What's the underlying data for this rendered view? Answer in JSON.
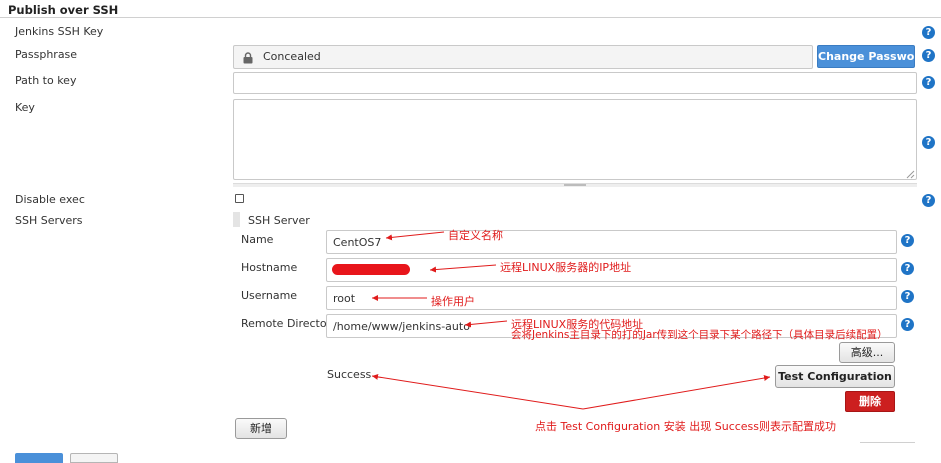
{
  "section": {
    "title": "Publish over SSH"
  },
  "form": {
    "jenkins_ssh_key_label": "Jenkins SSH Key",
    "passphrase_label": "Passphrase",
    "passphrase_value": "Concealed",
    "change_password_label": "Change Password",
    "path_to_key_label": "Path to key",
    "path_to_key_value": "",
    "key_label": "Key",
    "key_value": "",
    "disable_exec_label": "Disable exec",
    "disable_exec_checked": false,
    "ssh_servers_label": "SSH Servers"
  },
  "server": {
    "header": "SSH Server",
    "name_label": "Name",
    "name_value": "CentOS7",
    "hostname_label": "Hostname",
    "hostname_value": "",
    "username_label": "Username",
    "username_value": "root",
    "remote_directory_label": "Remote Directory",
    "remote_directory_value": "/home/www/jenkins-auto",
    "advanced_label": "高级...",
    "status_text": "Success",
    "test_configuration_label": "Test Configuration",
    "delete_label": "删除"
  },
  "add_label": "新增",
  "help_glyph": "?",
  "annotations": {
    "name": "自定义名称",
    "hostname": "远程LINUX服务器的IP地址",
    "username": "操作用户",
    "remote_dir_line1": "远程LINUX服务的代码地址",
    "remote_dir_line2": "会将Jenkins主目录下的打的Jar传到这个目录下某个路径下（具体目录后续配置）",
    "test": "点击 Test Configuration 安装 出现 Success则表示配置成功"
  },
  "colors": {
    "annotation_red": "#e01b1b",
    "help_blue": "#1f74c6",
    "button_blue": "#4a90d9",
    "button_red": "#cc1f1f"
  }
}
